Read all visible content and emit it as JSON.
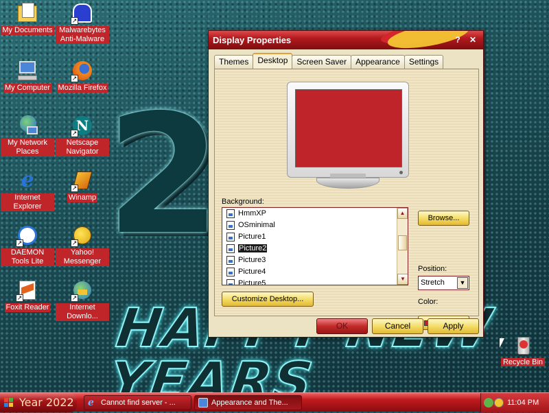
{
  "desktop": {
    "year_deco": "20",
    "banner_deco": "HAPPY NEW YEARS",
    "icons": [
      {
        "label": "My Documents",
        "icon": "folder-documents-icon"
      },
      {
        "label": "Malwarebytes Anti-Malware",
        "icon": "malwarebytes-icon"
      },
      {
        "label": "My Computer",
        "icon": "computer-icon"
      },
      {
        "label": "Mozilla Firefox",
        "icon": "firefox-icon"
      },
      {
        "label": "My Network Places",
        "icon": "network-icon"
      },
      {
        "label": "Netscape Navigator",
        "icon": "netscape-icon"
      },
      {
        "label": "Internet Explorer",
        "icon": "ie-icon"
      },
      {
        "label": "Winamp",
        "icon": "winamp-icon"
      },
      {
        "label": "DAEMON Tools Lite",
        "icon": "daemon-tools-icon"
      },
      {
        "label": "Yahoo! Messenger",
        "icon": "yahoo-messenger-icon"
      },
      {
        "label": "Foxit Reader",
        "icon": "foxit-icon"
      },
      {
        "label": "Internet Downlo...",
        "icon": "idm-icon"
      }
    ],
    "recycle_bin": "Recycle Bin"
  },
  "window": {
    "title": "Display Properties",
    "help_btn": "?",
    "close_btn": "✕",
    "tabs": [
      "Themes",
      "Desktop",
      "Screen Saver",
      "Appearance",
      "Settings"
    ],
    "active_tab": "Desktop",
    "background_label": "Background:",
    "background_items": [
      "HmmXP",
      "OSminimal",
      "Picture1",
      "Picture2",
      "Picture3",
      "Picture4",
      "Picture5"
    ],
    "selected_item": "Picture2",
    "browse_label": "Browse...",
    "position_label": "Position:",
    "position_value": "Stretch",
    "color_label": "Color:",
    "color_value": "#c0242b",
    "customize_label": "Customize Desktop...",
    "ok_label": "OK",
    "cancel_label": "Cancel",
    "apply_label": "Apply"
  },
  "taskbar": {
    "start_label": "Year 2022",
    "tasks": [
      {
        "label": "Cannot find server - ...",
        "icon": "ie-icon"
      },
      {
        "label": "Appearance and The...",
        "icon": "display-properties-icon"
      }
    ],
    "clock": "11:04 PM"
  },
  "colors": {
    "accent_red": "#c0252a",
    "title_red": "#b11a1e",
    "button_gold": "#f4dd6a",
    "preview_red": "#c0242b"
  }
}
